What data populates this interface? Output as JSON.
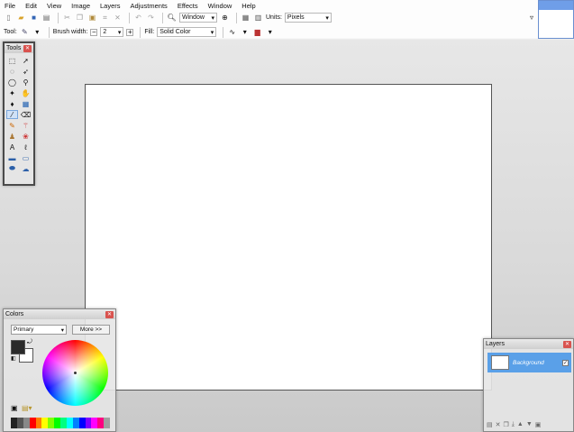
{
  "menu": [
    "File",
    "Edit",
    "View",
    "Image",
    "Layers",
    "Adjustments",
    "Effects",
    "Window",
    "Help"
  ],
  "toolbar": {
    "zoom_combo": "Window",
    "units_label": "Units:",
    "units_value": "Pixels"
  },
  "options": {
    "tool_label": "Tool:",
    "brush_label": "Brush width:",
    "brush_value": "2",
    "fill_label": "Fill:",
    "fill_value": "Solid Color"
  },
  "tools_window": {
    "title": "Tools"
  },
  "colors_window": {
    "title": "Colors",
    "mode": "Primary",
    "more_label": "More >>",
    "primary_color": "#2a2a2a",
    "secondary_color": "#ffffff",
    "palette": [
      "#222222",
      "#555555",
      "#888888",
      "#ff0000",
      "#ff7f00",
      "#ffff00",
      "#80ff00",
      "#00ff00",
      "#00ff80",
      "#00ffff",
      "#0080ff",
      "#0000ff",
      "#8000ff",
      "#ff00ff",
      "#ff0080",
      "#a0a0a0"
    ]
  },
  "layers_window": {
    "title": "Layers",
    "layer_name": "Background"
  },
  "colors": {
    "accent": "#5aa0e8",
    "close": "#d9534f"
  }
}
